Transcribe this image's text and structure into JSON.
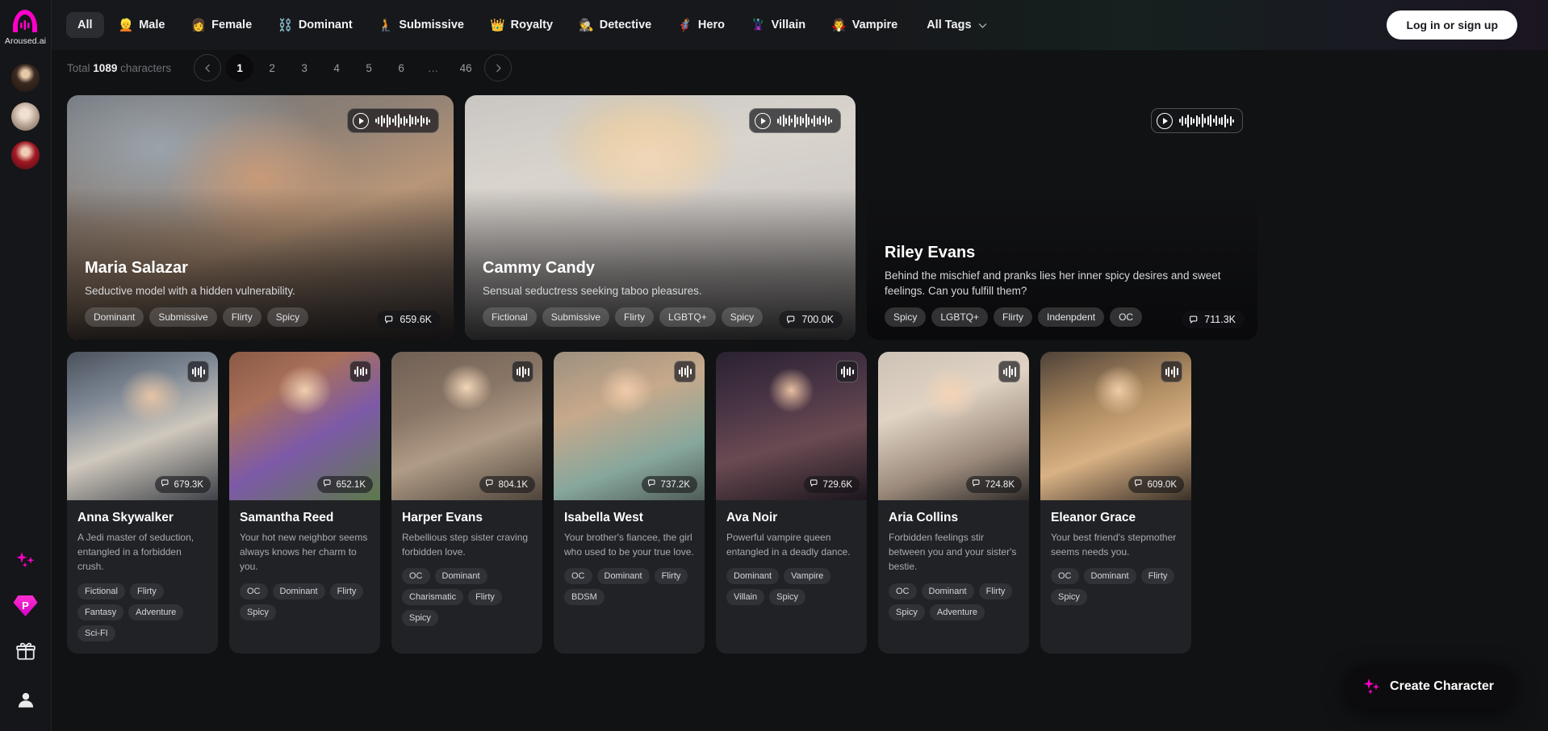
{
  "brand": {
    "name": "Aroused.ai",
    "logo_icon": "aroused-logo-icon",
    "accent_color": "#ff00c8"
  },
  "sidebar": {
    "avatars": [
      {
        "name": "recent-character-1"
      },
      {
        "name": "recent-character-2"
      },
      {
        "name": "recent-character-3"
      }
    ],
    "bottom_icons": [
      {
        "icon": "sparkles-icon",
        "label": "Sparkles"
      },
      {
        "icon": "premium-diamond-icon",
        "label": "P"
      },
      {
        "icon": "gift-icon",
        "label": "Gift"
      },
      {
        "icon": "user-profile-icon",
        "label": "Profile"
      }
    ]
  },
  "topnav": {
    "tabs": [
      {
        "emoji": "",
        "label": "All",
        "active": true
      },
      {
        "emoji": "👱",
        "label": "Male",
        "active": false
      },
      {
        "emoji": "👩",
        "label": "Female",
        "active": false
      },
      {
        "emoji": "⛓️",
        "label": "Dominant",
        "active": false
      },
      {
        "emoji": "🧎",
        "label": "Submissive",
        "active": false
      },
      {
        "emoji": "👑",
        "label": "Royalty",
        "active": false
      },
      {
        "emoji": "🕵️",
        "label": "Detective",
        "active": false
      },
      {
        "emoji": "🦸",
        "label": "Hero",
        "active": false
      },
      {
        "emoji": "🦹",
        "label": "Villain",
        "active": false
      },
      {
        "emoji": "🧛",
        "label": "Vampire",
        "active": false
      }
    ],
    "all_tags_label": "All Tags",
    "login_label": "Log in or sign up"
  },
  "toolbar": {
    "total_prefix": "Total",
    "total_count": "1089",
    "total_suffix": "characters",
    "pagination": {
      "prev_icon": "chevron-left-icon",
      "next_icon": "chevron-right-icon",
      "pages": [
        "1",
        "2",
        "3",
        "4",
        "5",
        "6",
        "…",
        "46"
      ],
      "current": "1"
    }
  },
  "featured": [
    {
      "name": "Maria Salazar",
      "description": "Seductive model with a hidden vulnerability.",
      "tags": [
        "Dominant",
        "Submissive",
        "Flirty",
        "Spicy"
      ],
      "chats": "659.6K",
      "has_audio": true
    },
    {
      "name": "Cammy Candy",
      "description": "Sensual seductress seeking taboo pleasures.",
      "tags": [
        "Fictional",
        "Submissive",
        "Flirty",
        "LGBTQ+",
        "Spicy"
      ],
      "chats": "700.0K",
      "has_audio": true
    },
    {
      "name": "Riley Evans",
      "description": "Behind the mischief and pranks lies her inner spicy desires and sweet feelings. Can you fulfill them?",
      "tags": [
        "Spicy",
        "LGBTQ+",
        "Flirty",
        "Indenpdent",
        "OC"
      ],
      "chats": "711.3K",
      "has_audio": true
    }
  ],
  "grid": [
    {
      "name": "Anna Skywalker",
      "description": "A Jedi master of seduction, entangled in a forbidden crush.",
      "tags": [
        "Fictional",
        "Flirty",
        "Fantasy",
        "Adventure",
        "Sci-FI"
      ],
      "chats": "679.3K"
    },
    {
      "name": "Samantha Reed",
      "description": "Your hot new neighbor seems always knows her charm to you.",
      "tags": [
        "OC",
        "Dominant",
        "Flirty",
        "Spicy"
      ],
      "chats": "652.1K"
    },
    {
      "name": "Harper Evans",
      "description": "Rebellious step sister craving forbidden love.",
      "tags": [
        "OC",
        "Dominant",
        "Charismatic",
        "Flirty",
        "Spicy"
      ],
      "chats": "804.1K"
    },
    {
      "name": "Isabella West",
      "description": "Your brother's fiancee, the girl who used to be your true love.",
      "tags": [
        "OC",
        "Dominant",
        "Flirty",
        "BDSM"
      ],
      "chats": "737.2K"
    },
    {
      "name": "Ava Noir",
      "description": "Powerful vampire queen entangled in a deadly dance.",
      "tags": [
        "Dominant",
        "Vampire",
        "Villain",
        "Spicy"
      ],
      "chats": "729.6K"
    },
    {
      "name": "Aria Collins",
      "description": "Forbidden feelings stir between you and your sister's bestie.",
      "tags": [
        "OC",
        "Dominant",
        "Flirty",
        "Spicy",
        "Adventure"
      ],
      "chats": "724.8K"
    },
    {
      "name": "Eleanor Grace",
      "description": "Your best friend's stepmother seems needs you.",
      "tags": [
        "OC",
        "Dominant",
        "Flirty",
        "Spicy"
      ],
      "chats": "609.0K"
    }
  ],
  "create_button": {
    "label": "Create Character",
    "icon": "sparkles-icon"
  }
}
